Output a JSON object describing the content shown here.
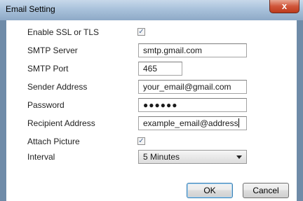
{
  "window": {
    "title": "Email Setting",
    "close_glyph": "x",
    "accent": "#3c7fb1",
    "close_color": "#c7472a"
  },
  "form": {
    "ssl": {
      "label": "Enable SSL or TLS",
      "checked": true,
      "check_glyph": "✓"
    },
    "smtp_server": {
      "label": "SMTP Server",
      "value": "smtp.gmail.com"
    },
    "smtp_port": {
      "label": "SMTP Port",
      "value": "465"
    },
    "sender": {
      "label": "Sender Address",
      "value": "your_email@gmail.com"
    },
    "password": {
      "label": "Password",
      "value": "●●●●●●"
    },
    "recipient": {
      "label": "Recipient Address",
      "value": "example_email@address"
    },
    "attach": {
      "label": "Attach Picture",
      "checked": true,
      "check_glyph": "✓"
    },
    "interval": {
      "label": "Interval",
      "selected": "5 Minutes"
    }
  },
  "buttons": {
    "ok": "OK",
    "cancel": "Cancel"
  }
}
